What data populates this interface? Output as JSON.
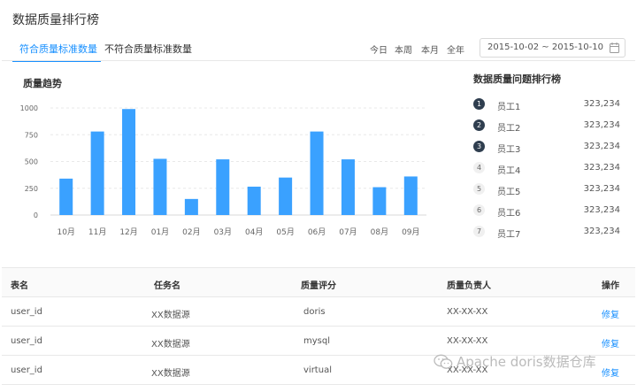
{
  "header": {
    "title": "数据质量排行榜",
    "tabs": [
      {
        "label": "符合质量标准数量",
        "active": true
      },
      {
        "label": "不符合质量标准数量",
        "active": false
      }
    ],
    "ranges": [
      "今日",
      "本周",
      "本月",
      "全年"
    ],
    "date_range": "2015-10-02 ~ 2015-10-10"
  },
  "trend": {
    "title": "质量趋势"
  },
  "chart_data": {
    "type": "bar",
    "title": "质量趋势",
    "categories": [
      "10月",
      "11月",
      "12月",
      "01月",
      "02月",
      "03月",
      "04月",
      "05月",
      "06月",
      "07月",
      "08月",
      "09月"
    ],
    "values": [
      340,
      780,
      990,
      525,
      150,
      520,
      265,
      350,
      780,
      520,
      260,
      360
    ],
    "yticks": [
      0,
      250,
      500,
      750,
      1000
    ],
    "ylim": [
      0,
      1000
    ],
    "grid": true,
    "color": "#3aa1ff"
  },
  "ranking": {
    "title": "数据质量问题排行榜",
    "items": [
      {
        "rank": "1",
        "name": "员工1",
        "value": "323,234"
      },
      {
        "rank": "2",
        "name": "员工2",
        "value": "323,234"
      },
      {
        "rank": "3",
        "name": "员工3",
        "value": "323,234"
      },
      {
        "rank": "4",
        "name": "员工4",
        "value": "323,234"
      },
      {
        "rank": "5",
        "name": "员工5",
        "value": "323,234"
      },
      {
        "rank": "6",
        "name": "员工6",
        "value": "323,234"
      },
      {
        "rank": "7",
        "name": "员工7",
        "value": "323,234"
      }
    ]
  },
  "table": {
    "columns": [
      "表名",
      "任务名",
      "质量评分",
      "质量负责人",
      "操作"
    ],
    "rows": [
      {
        "table": "user_id",
        "task": "XX数据源",
        "score": "doris",
        "owner": "XX-XX-XX",
        "action": "修复"
      },
      {
        "table": "user_id",
        "task": "XX数据源",
        "score": "mysql",
        "owner": "XX-XX-XX",
        "action": "修复"
      },
      {
        "table": "user_id",
        "task": "XX数据源",
        "score": "virtual",
        "owner": "XX-XX-XX",
        "action": "修复"
      }
    ]
  },
  "watermark": {
    "text": "Apache doris数据仓库"
  }
}
